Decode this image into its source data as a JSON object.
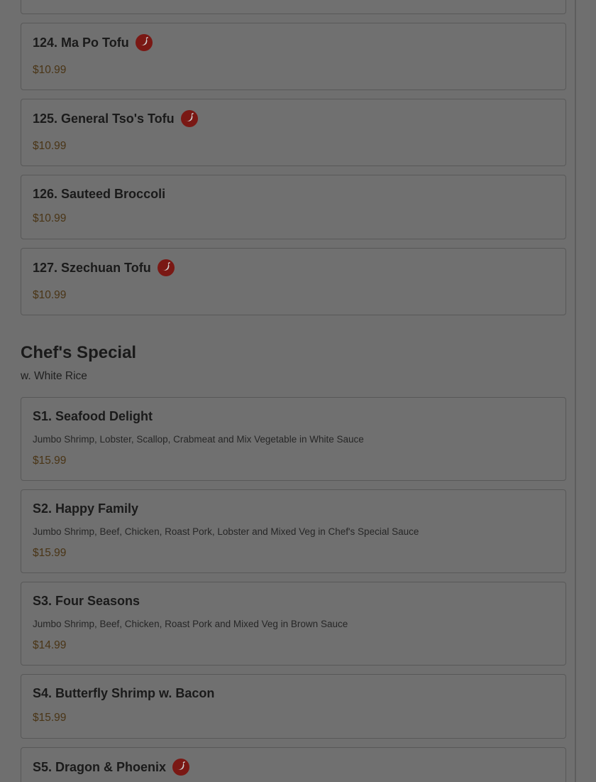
{
  "sections": [
    {
      "items": [
        {
          "name": "124. Ma Po Tofu",
          "spicy": true,
          "price": "$10.99"
        },
        {
          "name": "125. General Tso's Tofu",
          "spicy": true,
          "price": "$10.99"
        },
        {
          "name": "126. Sauteed Broccoli",
          "spicy": false,
          "price": "$10.99"
        },
        {
          "name": "127. Szechuan Tofu",
          "spicy": true,
          "price": "$10.99"
        }
      ]
    },
    {
      "title": "Chef's Special",
      "subtitle": "w. White Rice",
      "items": [
        {
          "name": "S1. Seafood Delight",
          "description": "Jumbo Shrimp, Lobster, Scallop, Crabmeat and Mix Vegetable in White Sauce",
          "price": "$15.99"
        },
        {
          "name": "S2. Happy Family",
          "description": "Jumbo Shrimp, Beef, Chicken, Roast Pork, Lobster and Mixed Veg in Chef's Special Sauce",
          "price": "$15.99"
        },
        {
          "name": "S3. Four Seasons",
          "description": "Jumbo Shrimp, Beef, Chicken, Roast Pork and Mixed Veg in Brown Sauce",
          "price": "$14.99"
        },
        {
          "name": "S4. Butterfly Shrimp w. Bacon",
          "price": "$15.99"
        },
        {
          "name": "S5. Dragon & Phoenix",
          "spicy": true
        }
      ]
    }
  ],
  "icons": {
    "spicy": "chili-pepper-icon"
  },
  "colors": {
    "spicy_badge": "#7a1814",
    "price": "#4a3516",
    "overlay": "#6f6f6f"
  }
}
